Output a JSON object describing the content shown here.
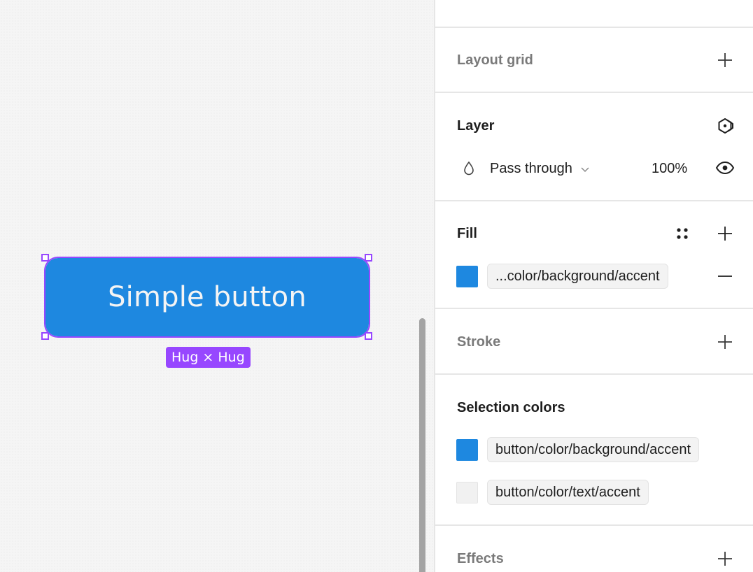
{
  "canvas": {
    "button_label": "Simple button",
    "size_badge": "Hug × Hug",
    "button_color": "#1e88e0",
    "selection_color": "#9747ff"
  },
  "panel": {
    "layout_grid": {
      "title": "Layout grid",
      "add_icon": "plus-icon"
    },
    "layer": {
      "title": "Layer",
      "component_icon": "component-instance-icon",
      "blend_icon": "blend-mode-drop-icon",
      "blend_mode": "Pass through",
      "opacity": "100%",
      "visibility_icon": "eye-icon"
    },
    "fill": {
      "title": "Fill",
      "styles_icon": "style-grid-icon",
      "add_icon": "plus-icon",
      "swatch_color": "#1e88e0",
      "style_name": "...color/background/accent",
      "remove_icon": "minus-icon"
    },
    "stroke": {
      "title": "Stroke",
      "add_icon": "plus-icon"
    },
    "selection_colors": {
      "title": "Selection colors",
      "items": [
        {
          "color": "#1e88e0",
          "name": "button/color/background/accent"
        },
        {
          "color": "#f1f1f1",
          "name": "button/color/text/accent"
        }
      ]
    },
    "effects": {
      "title": "Effects",
      "add_icon": "plus-icon"
    }
  }
}
